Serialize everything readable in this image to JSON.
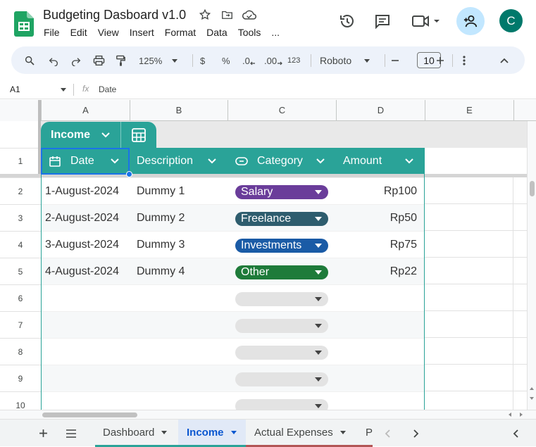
{
  "app": {
    "title": "Budgeting Dasboard v1.0",
    "menu": [
      "File",
      "Edit",
      "View",
      "Insert",
      "Format",
      "Data",
      "Tools",
      "..."
    ],
    "avatar_letter": "C"
  },
  "toolbar": {
    "zoom": "125%",
    "currency": "$",
    "percent": "%",
    "dec_decrease": ".0",
    "dec_increase": ".00",
    "number_format": "123",
    "font": "Roboto",
    "font_size": "10"
  },
  "formula_bar": {
    "cell_ref": "A1",
    "fx": "fx",
    "value": "Date"
  },
  "columns": [
    "A",
    "B",
    "C",
    "D",
    "E"
  ],
  "rows": [
    "1",
    "2",
    "3",
    "4",
    "5",
    "6",
    "7",
    "8",
    "9",
    "10"
  ],
  "table": {
    "name": "Income",
    "headers": {
      "date": "Date",
      "description": "Description",
      "category": "Category",
      "amount": "Amount"
    },
    "records": [
      {
        "date": "1-August-2024",
        "description": "Dummy 1",
        "category": "Salary",
        "amount": "Rp100"
      },
      {
        "date": "2-August-2024",
        "description": "Dummy 2",
        "category": "Freelance",
        "amount": "Rp50"
      },
      {
        "date": "3-August-2024",
        "description": "Dummy 3",
        "category": "Investments",
        "amount": "Rp75"
      },
      {
        "date": "4-August-2024",
        "description": "Dummy 4",
        "category": "Other",
        "amount": "Rp22"
      }
    ],
    "chip_colors": {
      "Salary": "#6a3d9a",
      "Freelance": "#2e5d6e",
      "Investments": "#1a5ba6",
      "Other": "#1e7b3a"
    }
  },
  "sheets": [
    {
      "name": "Dashboard",
      "color": "#2aa398"
    },
    {
      "name": "Income",
      "color": "#2aa398"
    },
    {
      "name": "Actual Expenses",
      "color": "#b25555"
    },
    {
      "name": "P",
      "color": "#b25555"
    }
  ],
  "colors": {
    "accent": "#2aa398",
    "selection": "#1a73e8",
    "active_sheet": "#0b57d0"
  }
}
